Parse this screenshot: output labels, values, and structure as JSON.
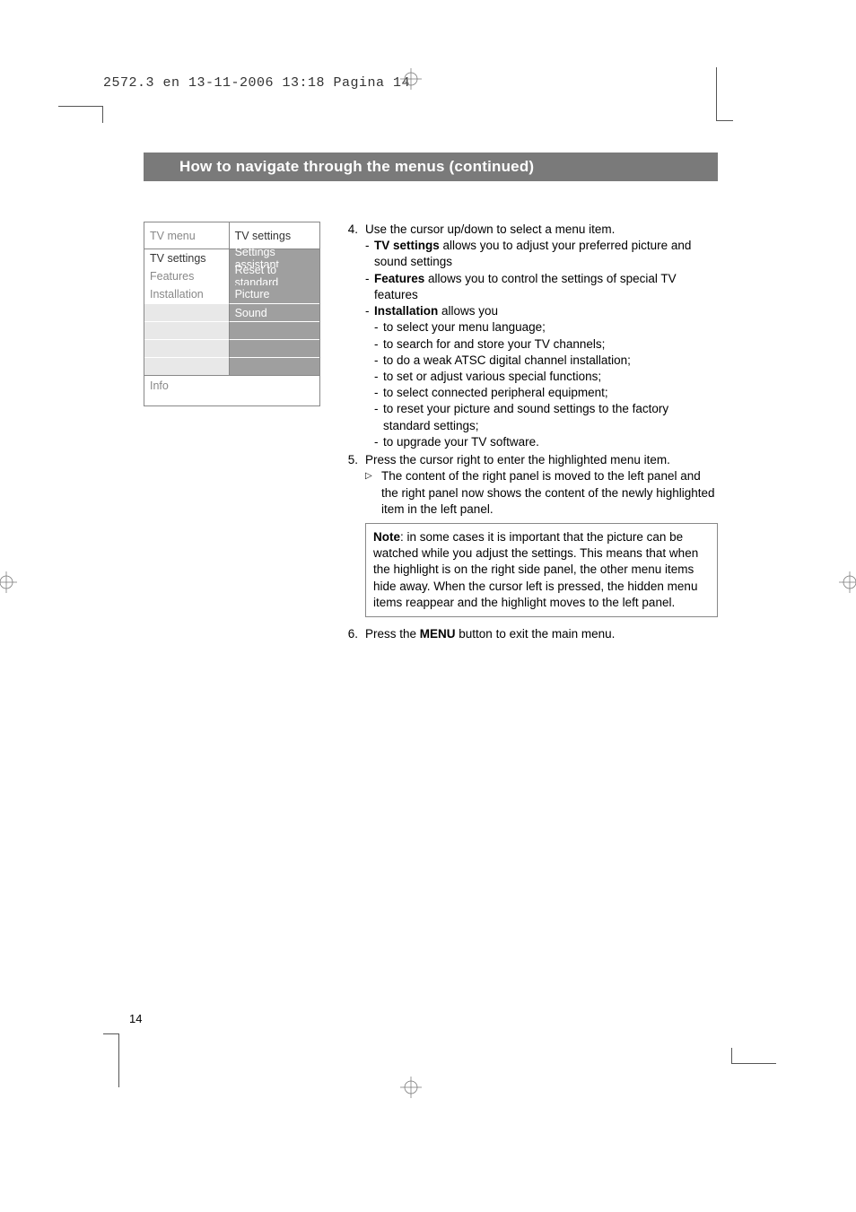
{
  "crop_info": "2572.3 en  13-11-2006  13:18  Pagina 14",
  "title": "How to navigate through the menus  (continued)",
  "menu": {
    "left_header": "TV menu",
    "right_header": "TV settings",
    "left_items": [
      "TV settings",
      "Features",
      "Installation"
    ],
    "right_items": [
      "Settings assistant",
      "Reset to standard",
      "Picture",
      "Sound"
    ],
    "info_label": "Info"
  },
  "steps": {
    "s4": {
      "num": "4.",
      "lead": "Use the cursor up/down to select a menu item.",
      "b1_bold": "TV settings",
      "b1_rest": " allows you to adjust your preferred picture and sound settings",
      "b2_bold": "Features",
      "b2_rest": " allows you to control the settings of special TV features",
      "b3_bold": "Installation",
      "b3_rest": " allows you",
      "b3_subs": [
        "to select your menu language;",
        "to search for and store your TV channels;",
        "to do a weak ATSC digital channel installation;",
        "to set or adjust various special functions;",
        "to select connected peripheral equipment;",
        "to reset your picture and sound settings to the factory standard settings;",
        "to upgrade your TV software."
      ]
    },
    "s5": {
      "num": "5.",
      "lead": "Press the cursor right to enter the highlighted menu item.",
      "tri_text": "The content of the right panel is moved to the left panel and the right panel now shows the content of the newly highlighted item in the left panel."
    },
    "note_bold": "Note",
    "note_rest": ": in some cases it is important that the picture can be watched while you adjust the settings. This means that when the highlight is on the right side panel, the other menu items hide away. When the cursor left is pressed, the hidden menu items reappear and the highlight moves to the left panel.",
    "s6": {
      "num": "6.",
      "pre": "Press the ",
      "bold": "MENU",
      "post": " button to exit the main menu."
    }
  },
  "page_number": "14"
}
